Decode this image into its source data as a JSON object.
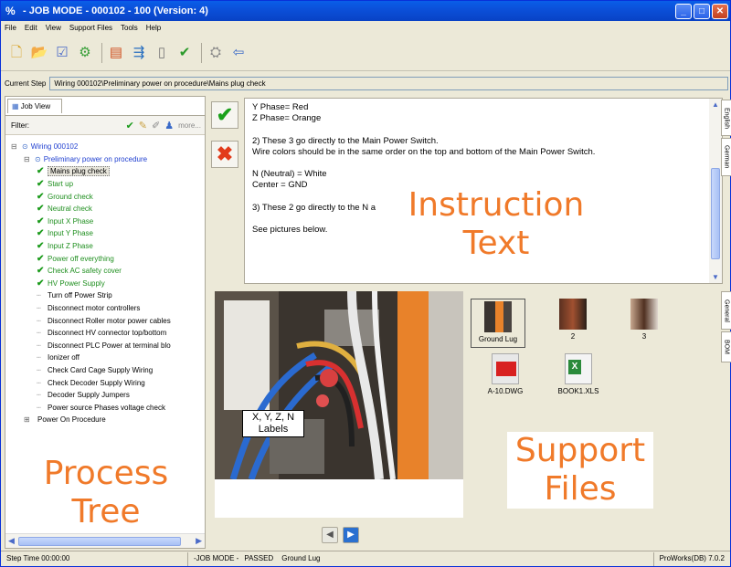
{
  "window": {
    "title": "- JOB MODE - 000102 - 100 (Version: 4)",
    "minimize": "_",
    "maximize": "□",
    "close": "✕"
  },
  "menu": [
    "File",
    "Edit",
    "View",
    "Support Files",
    "Tools",
    "Help"
  ],
  "toolbar": [
    "new-document-icon",
    "open-folder-icon",
    "checklist-icon",
    "settings-gear-icon",
    "panel-layout-icon",
    "export-icon",
    "page-icon",
    "approve-check-icon",
    "network-icon",
    "exit-door-icon"
  ],
  "current_step": {
    "label": "Current Step",
    "value": "Wiring 000102\\Preliminary power on procedure\\Mains plug check"
  },
  "left_panel": {
    "tab": "Job View",
    "filter_label": "Filter:",
    "more": "more...",
    "tree": [
      {
        "label": "Wiring 000102",
        "level": 0,
        "style": "blue",
        "expander": "⊟"
      },
      {
        "label": "Preliminary power on procedure",
        "level": 1,
        "style": "blue",
        "expander": "⊟"
      },
      {
        "label": "Mains plug check",
        "level": 2,
        "style": "sel"
      },
      {
        "label": "Start up",
        "level": 2,
        "style": "green"
      },
      {
        "label": "Ground check",
        "level": 2,
        "style": "green"
      },
      {
        "label": "Neutral check",
        "level": 2,
        "style": "green"
      },
      {
        "label": "Input X Phase",
        "level": 2,
        "style": "green"
      },
      {
        "label": "Input Y Phase",
        "level": 2,
        "style": "green"
      },
      {
        "label": "Input Z Phase",
        "level": 2,
        "style": "green"
      },
      {
        "label": "Power off everything",
        "level": 2,
        "style": "green"
      },
      {
        "label": "Check AC safety cover",
        "level": 2,
        "style": "green"
      },
      {
        "label": "HV Power Supply",
        "level": 2,
        "style": "green"
      },
      {
        "label": "Turn off Power Strip",
        "level": 2,
        "style": "plain"
      },
      {
        "label": "Disconnect motor controllers",
        "level": 2,
        "style": "plain"
      },
      {
        "label": "Disconnect Roller motor power cables",
        "level": 2,
        "style": "plain"
      },
      {
        "label": "Disconnect HV connector top/bottom",
        "level": 2,
        "style": "plain"
      },
      {
        "label": "Disconnect PLC Power at terminal blo",
        "level": 2,
        "style": "plain"
      },
      {
        "label": "Ionizer off",
        "level": 2,
        "style": "plain"
      },
      {
        "label": "Check Card Cage Supply Wiring",
        "level": 2,
        "style": "plain"
      },
      {
        "label": "Check Decoder Supply Wiring",
        "level": 2,
        "style": "plain"
      },
      {
        "label": "Decoder Supply Jumpers",
        "level": 2,
        "style": "plain"
      },
      {
        "label": "Power source Phases voltage check",
        "level": 2,
        "style": "plain"
      },
      {
        "label": "Power On Procedure",
        "level": 1,
        "style": "plain",
        "expander": "⊞"
      }
    ]
  },
  "overlays": {
    "process_tree": "Process\nTree",
    "instruction_text": "Instruction\nText",
    "support_files": "Support\nFiles"
  },
  "instruction_lines": [
    "Y Phase= Red",
    "Z Phase= Orange",
    "",
    "2) These 3 go directly to the Main Power Switch.",
    "    Wire colors should be in the same order on the top and bottom of the Main Power Switch.",
    "",
    "N (Neutral) = White",
    "Center = GND",
    "",
    "3) These 2 go directly to the N a",
    "",
    "See pictures below."
  ],
  "side_tabs": {
    "english": "English",
    "german": "German",
    "general": "General",
    "bom": "BOM"
  },
  "photo_label": "X, Y, Z, N\nLabels",
  "support_files": [
    {
      "name": "Ground Lug",
      "selected": true
    },
    {
      "name": "2",
      "selected": false
    },
    {
      "name": "3",
      "selected": false
    },
    {
      "name": "A-10.DWG",
      "selected": false
    },
    {
      "name": "BOOK1.XLS",
      "selected": false
    }
  ],
  "status": {
    "step_time": "Step Time 00:00:00",
    "mode": "-JOB MODE -",
    "result": "PASSED",
    "file": "Ground Lug",
    "version": "ProWorks(DB) 7.0.2"
  },
  "colors": {
    "accent": "#0b4fd8",
    "pass": "#1aa01a",
    "fail": "#e23b1b",
    "overlay": "#f07a2a"
  }
}
